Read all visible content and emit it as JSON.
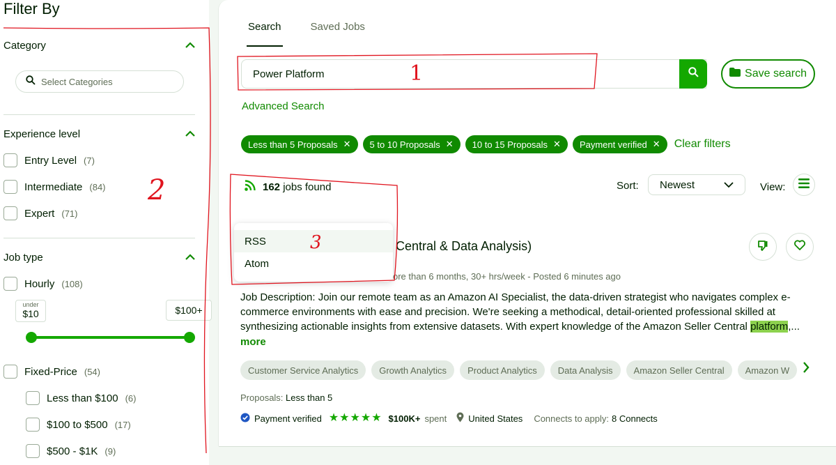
{
  "sidebar": {
    "title": "Filter By",
    "category": {
      "label": "Category",
      "search_placeholder": "Select Categories"
    },
    "experience": {
      "label": "Experience level",
      "items": [
        {
          "label": "Entry Level",
          "count": "(7)"
        },
        {
          "label": "Intermediate",
          "count": "(84)"
        },
        {
          "label": "Expert",
          "count": "(71)"
        }
      ]
    },
    "job_type": {
      "label": "Job type",
      "hourly": {
        "label": "Hourly",
        "count": "(108)"
      },
      "min_small": "under",
      "min_value": "$10",
      "max_value": "$100+",
      "fixed": {
        "label": "Fixed-Price",
        "count": "(54)"
      },
      "fixed_items": [
        {
          "label": "Less than $100",
          "count": "(6)"
        },
        {
          "label": "$100 to $500",
          "count": "(17)"
        },
        {
          "label": "$500 - $1K",
          "count": "(9)"
        }
      ]
    }
  },
  "main": {
    "tabs": [
      {
        "label": "Search"
      },
      {
        "label": "Saved Jobs"
      }
    ],
    "search_value": "Power Platform",
    "save_search": "Save search",
    "advanced_search": "Advanced Search",
    "chips": [
      {
        "label": "Less than 5 Proposals"
      },
      {
        "label": "5 to 10 Proposals"
      },
      {
        "label": "10 to 15 Proposals"
      },
      {
        "label": "Payment verified"
      }
    ],
    "clear_filters": "Clear filters",
    "jobs_count": "162",
    "jobs_suffix": "jobs found",
    "sort_label": "Sort:",
    "sort_value": "Newest",
    "view_label": "View:",
    "dropdown": [
      {
        "label": "RSS"
      },
      {
        "label": "Atom"
      }
    ],
    "job": {
      "title_fragment": "Central & Data Analysis)",
      "meta": "ore than 6 months, 30+ hrs/week - Posted 6 minutes ago",
      "description_before": "Job Description: Join our remote team as an Amazon AI Specialist, the data-driven strategist who navigates complex e-commerce environments with ease and precision. We're seeking a methodical, detail-oriented professional skilled at synthesizing actionable insights from extensive datasets. With expert knowledge of the Amazon Seller Central ",
      "description_highlight": "platform",
      "description_after": ",...",
      "more": "more",
      "skills": [
        {
          "label": "Customer Service Analytics"
        },
        {
          "label": "Growth Analytics"
        },
        {
          "label": "Product Analytics"
        },
        {
          "label": "Data Analysis"
        },
        {
          "label": "Amazon Seller Central"
        },
        {
          "label": "Amazon W"
        }
      ],
      "proposals_label": "Proposals:",
      "proposals_value": "Less than 5",
      "payment_verified": "Payment verified",
      "spent": "$100K+",
      "spent_suffix": "spent",
      "location": "United States",
      "connects_label": "Connects to apply:",
      "connects_value": "8 Connects"
    }
  },
  "annotations": {
    "one": "1",
    "two": "2",
    "three": "3"
  },
  "colors": {
    "brand_green": "#14a800",
    "dark_green": "#108a00",
    "annotation_red": "#e0141e"
  }
}
